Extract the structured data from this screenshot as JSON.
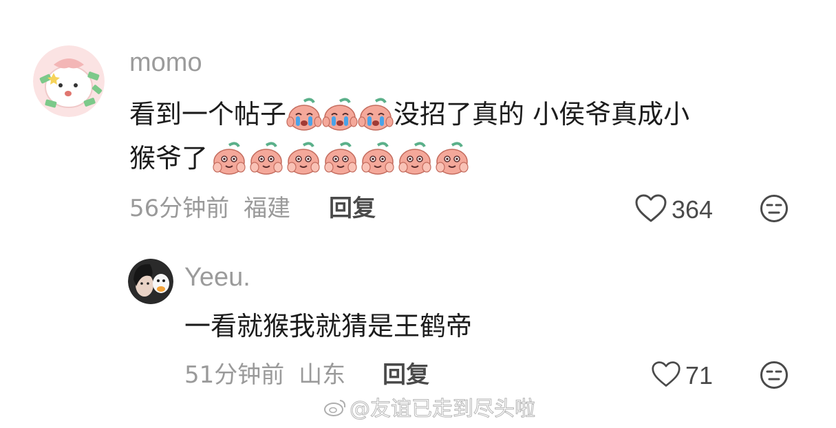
{
  "comment": {
    "username": "momo",
    "text_line1_a": "看到一个帖子",
    "text_line1_b": "没招了真的 小侯爷真成小",
    "text_line2": "猴爷了",
    "crying_emoji": "crying-peach-emoji",
    "happy_emoji": "hands-on-cheeks-peach-emoji",
    "time": "56分钟前",
    "location": "福建",
    "reply_label": "回复",
    "like_count": "364"
  },
  "reply": {
    "username": "Yeeu.",
    "text": "一看就猴我就猜是王鹤帝",
    "time": "51分钟前",
    "location": "山东",
    "reply_label": "回复",
    "like_count": "71"
  },
  "watermark": {
    "text": "@友谊已走到尽头啦"
  },
  "colors": {
    "meta_gray": "#9a9a9a",
    "emoji_peach": "#f4a89a",
    "emoji_leaf": "#5bb08a"
  }
}
